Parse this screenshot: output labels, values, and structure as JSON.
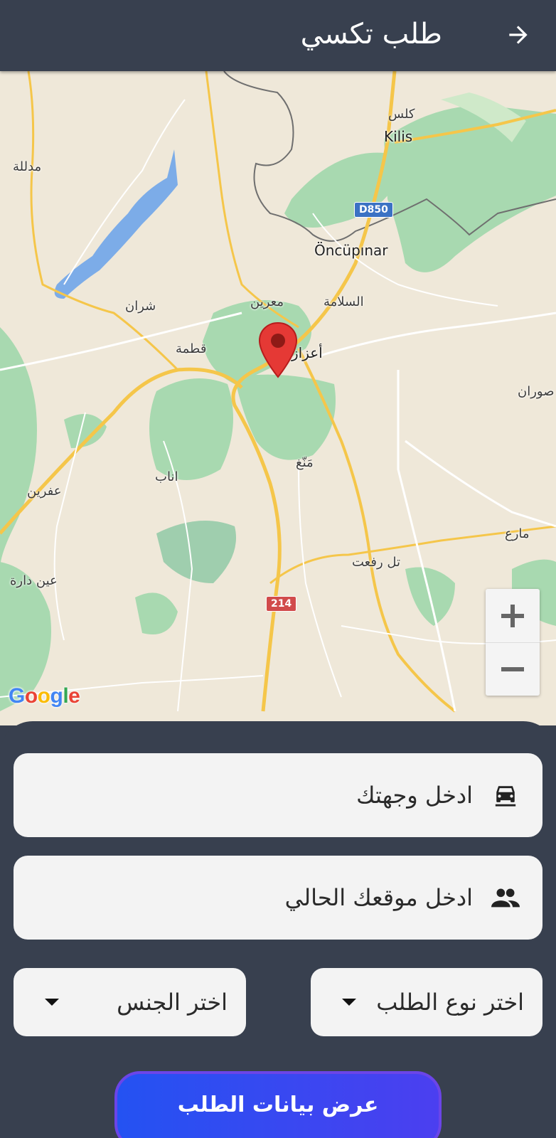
{
  "app_bar": {
    "title": "طلب تكسي",
    "back_icon": "arrow-forward-icon"
  },
  "map": {
    "labels": {
      "kilis_ar": "كلس",
      "kilis": "Kilis",
      "madlaleh": "مدللة",
      "d850": "D850",
      "oncupinar": "Öncüpınar",
      "shran": "شران",
      "maarin": "معرين",
      "salameh": "السلامة",
      "qatma": "قطمة",
      "azaz": "أعزاز",
      "sawran": "صوران",
      "managh": "مَنّغ",
      "anab": "اناب",
      "afrin": "عفرين",
      "mare": "مارع",
      "tal_rifaat": "تل رفعت",
      "ain_dara": "عين دارة",
      "r214": "214"
    },
    "attribution": "Google",
    "zoom_in_icon": "plus-icon",
    "zoom_out_icon": "minus-icon",
    "marker_icon": "map-pin-icon"
  },
  "form": {
    "destination_placeholder": "ادخل وجهتك",
    "destination_icon": "car-icon",
    "location_placeholder": "ادخل موقعك الحالي",
    "location_icon": "people-icon",
    "request_type": "اختر نوع الطلب",
    "gender": "اختر الجنس",
    "submit_label": "عرض بيانات الطلب"
  },
  "colors": {
    "app_bar": "#38404f",
    "field_bg": "#f3f3f3",
    "button_start": "#2452f2",
    "button_end": "#4b3ff0",
    "marker": "#e53935"
  }
}
